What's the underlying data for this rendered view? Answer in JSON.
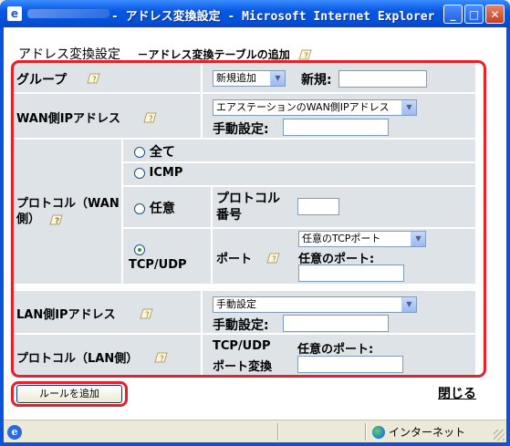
{
  "window": {
    "title": "- アドレス変換設定 - Microsoft Internet Explorer",
    "minimize_glyph": "_",
    "maximize_glyph": "□",
    "close_glyph": "✕"
  },
  "page": {
    "heading": "アドレス変換設定",
    "subheading": "－アドレス変換テーブルの追加",
    "group": {
      "label": "グループ",
      "select_value": "新規追加",
      "new_label": "新規:",
      "new_value": ""
    },
    "wan_ip": {
      "label": "WAN側IPアドレス",
      "select_value": "エアステーションのWAN側IPアドレス",
      "manual_label": "手動設定:",
      "manual_value": ""
    },
    "protocol_wan": {
      "label": "プロトコル（WAN側）",
      "options": [
        "全て",
        "ICMP",
        "任意",
        "TCP/UDP"
      ],
      "selected": "TCP/UDP",
      "protocol_number_label": "プロトコル番号",
      "protocol_number_value": "",
      "port_label": "ポート",
      "port_select_value": "任意のTCPポート",
      "any_port_label": "任意のポート:",
      "any_port_value": ""
    },
    "lan_ip": {
      "label": "LAN側IPアドレス",
      "select_value": "手動設定",
      "manual_label": "手動設定:",
      "manual_value": ""
    },
    "protocol_lan": {
      "label": "プロトコル（LAN側）",
      "tcpudp_label": "TCP/UDP",
      "port_convert_label": "ポート変換",
      "any_port_label": "任意のポート:",
      "any_port_value": ""
    },
    "add_rule_button": "ルールを追加",
    "close_link": "閉じる"
  },
  "statusbar": {
    "zone": "インターネット"
  },
  "colors": {
    "titlebar": "#0858e2",
    "cell_bg": "#dde3e7",
    "highlight_border": "#e8202a"
  }
}
